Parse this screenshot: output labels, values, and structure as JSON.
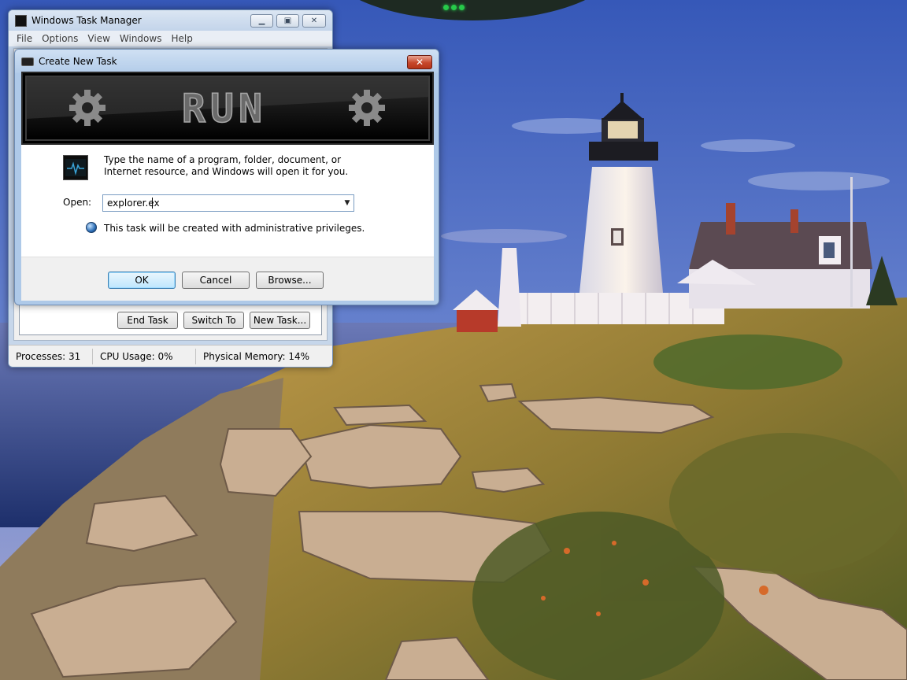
{
  "task_manager": {
    "title": "Windows Task Manager",
    "menu": [
      "File",
      "Options",
      "View",
      "Windows",
      "Help"
    ],
    "buttons": {
      "end_task": "End Task",
      "switch_to": "Switch To",
      "new_task": "New Task..."
    },
    "status": {
      "processes": "Processes: 31",
      "cpu": "CPU Usage: 0%",
      "memory": "Physical Memory: 14%"
    }
  },
  "run_dialog": {
    "title": "Create New Task",
    "description": "Type the name of a program, folder, document, or Internet resource, and Windows will open it for you.",
    "open_label": "Open:",
    "open_value": "explorer.ex",
    "admin_note": "This task will be created with administrative privileges.",
    "banner_text": "RUN",
    "buttons": {
      "ok": "OK",
      "cancel": "Cancel",
      "browse": "Browse..."
    }
  },
  "icons": {
    "close": "close-icon",
    "minimize": "minimize-icon",
    "maximize": "maximize-icon",
    "dropdown": "chevron-down-icon",
    "shield": "shield-icon",
    "gear": "gear-icon"
  },
  "colors": {
    "dock_indicator": "#27c94a",
    "close_button": "#c7472b",
    "title_bar": "#c3d4ea"
  }
}
